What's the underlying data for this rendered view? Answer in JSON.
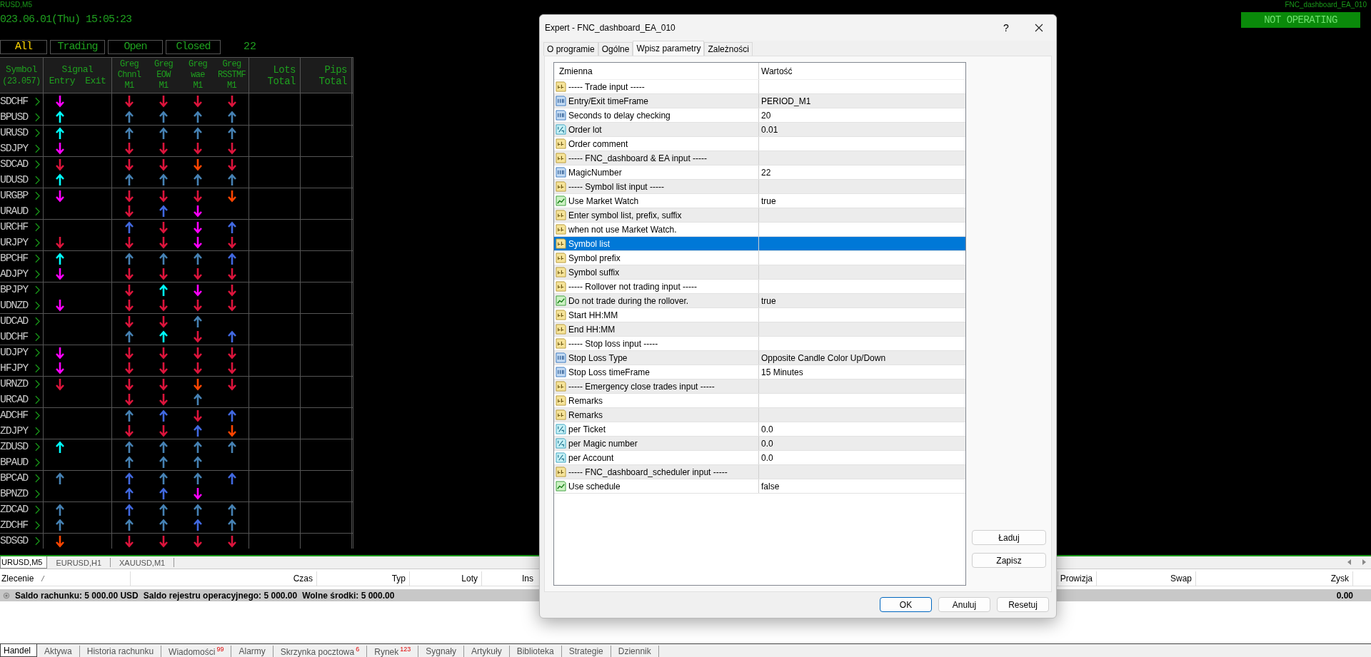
{
  "chart": {
    "symbol_label": "RUSD,M5",
    "datetime": "023.06.01(Thu) 15:05:23",
    "ea_name": "FNC_dashboard_EA_010",
    "status": "NOT OPERATING",
    "filters": [
      {
        "label": "All",
        "selected": true
      },
      {
        "label": "Trading",
        "selected": false
      },
      {
        "label": "Open",
        "selected": false
      },
      {
        "label": "Closed",
        "selected": false
      }
    ],
    "count": "22",
    "header": {
      "symbol": [
        "Symbol",
        "(23.057)"
      ],
      "signal": "Signal",
      "signal_sub": [
        "Entry",
        "Exit"
      ],
      "indicators": [
        [
          "Greg",
          "Chnnl",
          "M1"
        ],
        [
          "Greg",
          "EOW",
          "M1"
        ],
        [
          "Greg",
          "wae",
          "M1"
        ],
        [
          "Greg",
          "RSSTMF",
          "M1"
        ]
      ],
      "totals": [
        [
          "Lots",
          "Total"
        ],
        [
          "Pips",
          "Total"
        ]
      ]
    },
    "rows": [
      {
        "symbol": "SDCHF",
        "entry": {
          "kind": "down",
          "color": "#ff00ff"
        },
        "greg": [
          {
            "kind": "down",
            "color": "#dc143c"
          },
          {
            "kind": "down",
            "color": "#dc143c"
          },
          {
            "kind": "down",
            "color": "#dc143c"
          },
          {
            "kind": "down",
            "color": "#dc143c"
          }
        ]
      },
      {
        "symbol": "BPUSD",
        "entry": {
          "kind": "up",
          "color": "#00ffff"
        },
        "greg": [
          {
            "kind": "up",
            "color": "#4682b4"
          },
          {
            "kind": "up",
            "color": "#4682b4"
          },
          {
            "kind": "up",
            "color": "#4682b4"
          },
          {
            "kind": "up",
            "color": "#4682b4"
          }
        ]
      },
      {
        "symbol": "URUSD",
        "entry": {
          "kind": "up",
          "color": "#00ffff"
        },
        "greg": [
          {
            "kind": "up",
            "color": "#4682b4"
          },
          {
            "kind": "up",
            "color": "#4682b4"
          },
          {
            "kind": "up",
            "color": "#4682b4"
          },
          {
            "kind": "up",
            "color": "#4682b4"
          }
        ]
      },
      {
        "symbol": "SDJPY",
        "entry": {
          "kind": "down",
          "color": "#ff00ff"
        },
        "greg": [
          {
            "kind": "down",
            "color": "#dc143c"
          },
          {
            "kind": "down",
            "color": "#dc143c"
          },
          {
            "kind": "down",
            "color": "#dc143c"
          },
          {
            "kind": "down",
            "color": "#dc143c"
          }
        ]
      },
      {
        "symbol": "SDCAD",
        "entry": {
          "kind": "down",
          "color": "#dc143c"
        },
        "greg": [
          {
            "kind": "down",
            "color": "#dc143c"
          },
          {
            "kind": "down",
            "color": "#dc143c"
          },
          {
            "kind": "down",
            "color": "#ff4500"
          },
          {
            "kind": "down",
            "color": "#dc143c"
          }
        ]
      },
      {
        "symbol": "UDUSD",
        "entry": {
          "kind": "up",
          "color": "#00ffff"
        },
        "greg": [
          {
            "kind": "up",
            "color": "#4682b4"
          },
          {
            "kind": "up",
            "color": "#4682b4"
          },
          {
            "kind": "up",
            "color": "#4682b4"
          },
          {
            "kind": "up",
            "color": "#4682b4"
          }
        ]
      },
      {
        "symbol": "URGBP",
        "entry": {
          "kind": "down",
          "color": "#ff00ff"
        },
        "greg": [
          {
            "kind": "down",
            "color": "#dc143c"
          },
          {
            "kind": "down",
            "color": "#dc143c"
          },
          {
            "kind": "down",
            "color": "#dc143c"
          },
          {
            "kind": "down",
            "color": "#ff4500"
          }
        ]
      },
      {
        "symbol": "URAUD",
        "greg": [
          {
            "kind": "down",
            "color": "#dc143c"
          },
          {
            "kind": "up",
            "color": "#4169e1"
          },
          {
            "kind": "down",
            "color": "#ff00ff"
          },
          {
            "kind": "none"
          }
        ]
      },
      {
        "symbol": "URCHF",
        "greg": [
          {
            "kind": "up",
            "color": "#4169e1"
          },
          {
            "kind": "down",
            "color": "#dc143c"
          },
          {
            "kind": "down",
            "color": "#ff00ff"
          },
          {
            "kind": "up",
            "color": "#4169e1"
          }
        ]
      },
      {
        "symbol": "URJPY",
        "entry": {
          "kind": "down",
          "color": "#dc143c"
        },
        "greg": [
          {
            "kind": "down",
            "color": "#dc143c"
          },
          {
            "kind": "down",
            "color": "#dc143c"
          },
          {
            "kind": "down",
            "color": "#ff00ff"
          },
          {
            "kind": "down",
            "color": "#dc143c"
          }
        ]
      },
      {
        "symbol": "BPCHF",
        "entry": {
          "kind": "up",
          "color": "#00ffff"
        },
        "greg": [
          {
            "kind": "up",
            "color": "#4682b4"
          },
          {
            "kind": "up",
            "color": "#4682b4"
          },
          {
            "kind": "up",
            "color": "#4682b4"
          },
          {
            "kind": "up",
            "color": "#4169e1"
          }
        ]
      },
      {
        "symbol": "ADJPY",
        "entry": {
          "kind": "down",
          "color": "#ff00ff"
        },
        "greg": [
          {
            "kind": "down",
            "color": "#dc143c"
          },
          {
            "kind": "down",
            "color": "#dc143c"
          },
          {
            "kind": "down",
            "color": "#dc143c"
          },
          {
            "kind": "down",
            "color": "#dc143c"
          }
        ]
      },
      {
        "symbol": "BPJPY",
        "greg": [
          {
            "kind": "down",
            "color": "#dc143c"
          },
          {
            "kind": "up",
            "color": "#00ffff"
          },
          {
            "kind": "down",
            "color": "#ff00ff"
          },
          {
            "kind": "down",
            "color": "#dc143c"
          }
        ]
      },
      {
        "symbol": "UDNZD",
        "entry": {
          "kind": "down",
          "color": "#ff00ff"
        },
        "greg": [
          {
            "kind": "down",
            "color": "#dc143c"
          },
          {
            "kind": "down",
            "color": "#dc143c"
          },
          {
            "kind": "down",
            "color": "#dc143c"
          },
          {
            "kind": "down",
            "color": "#dc143c"
          }
        ]
      },
      {
        "symbol": "UDCAD",
        "greg": [
          {
            "kind": "down",
            "color": "#dc143c"
          },
          {
            "kind": "down",
            "color": "#dc143c"
          },
          {
            "kind": "up",
            "color": "#4682b4"
          },
          {
            "kind": "none"
          }
        ]
      },
      {
        "symbol": "UDCHF",
        "greg": [
          {
            "kind": "up",
            "color": "#4682b4"
          },
          {
            "kind": "up",
            "color": "#00ffff"
          },
          {
            "kind": "down",
            "color": "#dc143c"
          },
          {
            "kind": "up",
            "color": "#4169e1"
          }
        ]
      },
      {
        "symbol": "UDJPY",
        "entry": {
          "kind": "down",
          "color": "#ff00ff"
        },
        "greg": [
          {
            "kind": "down",
            "color": "#dc143c"
          },
          {
            "kind": "down",
            "color": "#dc143c"
          },
          {
            "kind": "down",
            "color": "#dc143c"
          },
          {
            "kind": "down",
            "color": "#dc143c"
          }
        ]
      },
      {
        "symbol": "HFJPY",
        "entry": {
          "kind": "down",
          "color": "#ff00ff"
        },
        "greg": [
          {
            "kind": "down",
            "color": "#dc143c"
          },
          {
            "kind": "down",
            "color": "#dc143c"
          },
          {
            "kind": "down",
            "color": "#dc143c"
          },
          {
            "kind": "down",
            "color": "#dc143c"
          }
        ]
      },
      {
        "symbol": "URNZD",
        "entry": {
          "kind": "down",
          "color": "#dc143c"
        },
        "greg": [
          {
            "kind": "down",
            "color": "#dc143c"
          },
          {
            "kind": "down",
            "color": "#dc143c"
          },
          {
            "kind": "down",
            "color": "#ff4500"
          },
          {
            "kind": "down",
            "color": "#dc143c"
          }
        ]
      },
      {
        "symbol": "URCAD",
        "greg": [
          {
            "kind": "down",
            "color": "#dc143c"
          },
          {
            "kind": "down",
            "color": "#dc143c"
          },
          {
            "kind": "up",
            "color": "#4682b4"
          },
          {
            "kind": "none"
          }
        ]
      },
      {
        "symbol": "ADCHF",
        "greg": [
          {
            "kind": "up",
            "color": "#4682b4"
          },
          {
            "kind": "up",
            "color": "#4169e1"
          },
          {
            "kind": "down",
            "color": "#dc143c"
          },
          {
            "kind": "up",
            "color": "#4169e1"
          }
        ]
      },
      {
        "symbol": "ZDJPY",
        "greg": [
          {
            "kind": "down",
            "color": "#dc143c"
          },
          {
            "kind": "down",
            "color": "#dc143c"
          },
          {
            "kind": "up",
            "color": "#4169e1"
          },
          {
            "kind": "down",
            "color": "#ff4500"
          }
        ]
      },
      {
        "symbol": "ZDUSD",
        "entry": {
          "kind": "up",
          "color": "#00ffff"
        },
        "greg": [
          {
            "kind": "up",
            "color": "#4682b4"
          },
          {
            "kind": "up",
            "color": "#4682b4"
          },
          {
            "kind": "up",
            "color": "#4682b4"
          },
          {
            "kind": "up",
            "color": "#4682b4"
          }
        ]
      },
      {
        "symbol": "BPAUD",
        "greg": [
          {
            "kind": "up",
            "color": "#4682b4"
          },
          {
            "kind": "up",
            "color": "#4682b4"
          },
          {
            "kind": "up",
            "color": "#4682b4"
          },
          {
            "kind": "none"
          }
        ]
      },
      {
        "symbol": "BPCAD",
        "entry": {
          "kind": "up",
          "color": "#4682b4"
        },
        "greg": [
          {
            "kind": "up",
            "color": "#4169e1"
          },
          {
            "kind": "up",
            "color": "#4682b4"
          },
          {
            "kind": "up",
            "color": "#4682b4"
          },
          {
            "kind": "up",
            "color": "#4169e1"
          }
        ]
      },
      {
        "symbol": "BPNZD",
        "greg": [
          {
            "kind": "up",
            "color": "#4169e1"
          },
          {
            "kind": "up",
            "color": "#4169e1"
          },
          {
            "kind": "down",
            "color": "#ff00ff"
          },
          {
            "kind": "none"
          }
        ]
      },
      {
        "symbol": "ZDCAD",
        "entry": {
          "kind": "up",
          "color": "#4682b4"
        },
        "greg": [
          {
            "kind": "up",
            "color": "#4169e1"
          },
          {
            "kind": "up",
            "color": "#4682b4"
          },
          {
            "kind": "up",
            "color": "#4682b4"
          },
          {
            "kind": "up",
            "color": "#4682b4"
          }
        ]
      },
      {
        "symbol": "ZDCHF",
        "entry": {
          "kind": "up",
          "color": "#4682b4"
        },
        "greg": [
          {
            "kind": "up",
            "color": "#4682b4"
          },
          {
            "kind": "up",
            "color": "#4682b4"
          },
          {
            "kind": "up",
            "color": "#4169e1"
          },
          {
            "kind": "up",
            "color": "#4682b4"
          }
        ]
      },
      {
        "symbol": "SDSGD",
        "entry": {
          "kind": "down",
          "color": "#ff4500"
        },
        "greg": [
          {
            "kind": "down",
            "color": "#dc143c"
          },
          {
            "kind": "down",
            "color": "#dc143c"
          },
          {
            "kind": "down",
            "color": "#dc143c"
          },
          {
            "kind": "down",
            "color": "#dc143c"
          }
        ]
      }
    ]
  },
  "chart_tabs": [
    {
      "label": "URUSD,M5",
      "selected": true
    },
    {
      "label": "EURUSD,H1",
      "selected": false
    },
    {
      "label": "XAUUSD,M1",
      "selected": false
    }
  ],
  "terminal": {
    "columns": [
      "Zlecenie",
      "Czas",
      "Typ",
      "Loty",
      "Ins",
      "Prowizja",
      "Swap",
      "Zysk"
    ],
    "balance": [
      "Saldo rachunku: 5 000.00 USD",
      "Saldo rejestru operacyjnego: 5 000.00",
      "Wolne środki: 5 000.00"
    ],
    "profit": "0.00",
    "tabs": [
      {
        "label": "Handel",
        "selected": true
      },
      {
        "label": "Aktywa",
        "selected": false
      },
      {
        "label": "Historia rachunku",
        "selected": false
      },
      {
        "label": "Wiadomości",
        "badge": "99",
        "selected": false
      },
      {
        "label": "Alarmy",
        "selected": false
      },
      {
        "label": "Skrzynka pocztowa",
        "badge": "6",
        "selected": false
      },
      {
        "label": "Rynek",
        "badge": "123",
        "selected": false
      },
      {
        "label": "Sygnały",
        "selected": false
      },
      {
        "label": "Artykuły",
        "selected": false
      },
      {
        "label": "Biblioteka",
        "selected": false
      },
      {
        "label": "Strategie",
        "selected": false
      },
      {
        "label": "Dziennik",
        "selected": false
      }
    ]
  },
  "dialog": {
    "title": "Expert - FNC_dashboard_EA_010",
    "help": "?",
    "tabs": [
      {
        "label": "O programie",
        "selected": false
      },
      {
        "label": "Ogólne",
        "selected": false
      },
      {
        "label": "Wpisz parametry",
        "selected": true
      },
      {
        "label": "Zależności",
        "selected": false
      }
    ],
    "columns": [
      "Zmienna",
      "Wartość"
    ],
    "params": [
      {
        "kind": "string",
        "name": "----- Trade input -----",
        "selected": false
      },
      {
        "kind": "int",
        "name": "Entry/Exit timeFrame",
        "value": "PERIOD_M1",
        "selected": false
      },
      {
        "kind": "int",
        "name": "Seconds to delay checking",
        "value": "20",
        "selected": false
      },
      {
        "kind": "double",
        "name": "Order lot",
        "value": "0.01",
        "selected": false
      },
      {
        "kind": "string",
        "name": "Order comment",
        "selected": false
      },
      {
        "kind": "string",
        "name": "----- FNC_dashboard & EA input -----",
        "selected": false
      },
      {
        "kind": "int",
        "name": "MagicNumber",
        "value": "22",
        "selected": false
      },
      {
        "kind": "string",
        "name": "----- Symbol list input -----",
        "selected": false
      },
      {
        "kind": "bool",
        "name": "Use Market Watch",
        "value": "true",
        "selected": false
      },
      {
        "kind": "string",
        "name": "Enter symbol list, prefix, suffix",
        "selected": false
      },
      {
        "kind": "string",
        "name": "when not use Market Watch.",
        "selected": false
      },
      {
        "kind": "string",
        "name": "Symbol list",
        "selected": true
      },
      {
        "kind": "string",
        "name": "Symbol prefix",
        "selected": false
      },
      {
        "kind": "string",
        "name": "Symbol suffix",
        "selected": false
      },
      {
        "kind": "string",
        "name": "----- Rollover not trading input -----",
        "selected": false
      },
      {
        "kind": "bool",
        "name": "Do not trade during the rollover.",
        "value": "true",
        "selected": false
      },
      {
        "kind": "string",
        "name": "Start HH:MM",
        "selected": false
      },
      {
        "kind": "string",
        "name": "End HH:MM",
        "selected": false
      },
      {
        "kind": "string",
        "name": "----- Stop loss input -----",
        "selected": false
      },
      {
        "kind": "int",
        "name": "Stop Loss Type",
        "value": "Opposite Candle Color Up/Down",
        "selected": false
      },
      {
        "kind": "int",
        "name": "Stop Loss timeFrame",
        "value": "15 Minutes",
        "selected": false
      },
      {
        "kind": "string",
        "name": "----- Emergency close trades input -----",
        "selected": false
      },
      {
        "kind": "string",
        "name": "Remarks",
        "selected": false
      },
      {
        "kind": "string",
        "name": "Remarks",
        "selected": false
      },
      {
        "kind": "double",
        "name": "per Ticket",
        "value": "0.0",
        "selected": false
      },
      {
        "kind": "double",
        "name": "per Magic number",
        "value": "0.0",
        "selected": false
      },
      {
        "kind": "double",
        "name": "per Account",
        "value": "0.0",
        "selected": false
      },
      {
        "kind": "string",
        "name": "----- FNC_dashboard_scheduler input -----",
        "selected": false
      },
      {
        "kind": "bool",
        "name": "Use schedule",
        "value": "false",
        "selected": false
      }
    ],
    "side_buttons": [
      "Ładuj",
      "Zapisz"
    ],
    "buttons": [
      "OK",
      "Anuluj",
      "Resetuj"
    ]
  }
}
